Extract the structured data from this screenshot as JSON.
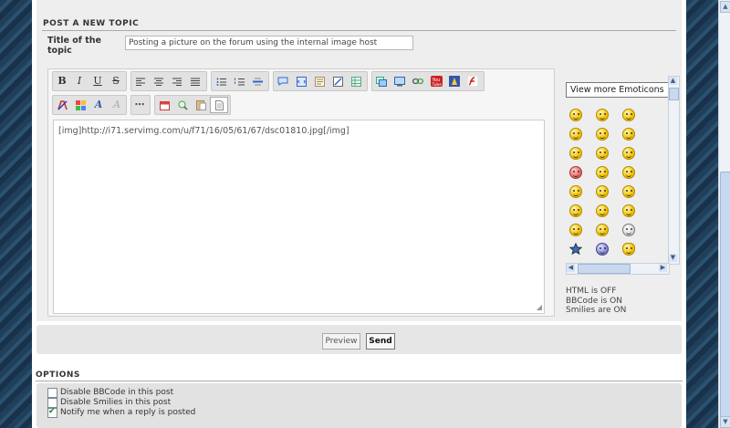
{
  "post_section": {
    "heading": "POST A NEW TOPIC",
    "title_label": "Title of the topic",
    "title_value": "Posting a picture on the forum using the internal image host"
  },
  "toolbar": {
    "row1": [
      "bold",
      "italic",
      "underline",
      "strikethrough",
      "align-left",
      "align-center",
      "align-right",
      "justify",
      "bulleted-list",
      "numbered-list",
      "horizontal-rule",
      "quote",
      "code",
      "spoiler",
      "hide",
      "table",
      "insert-image",
      "host-image",
      "insert-link",
      "youtube",
      "dailymotion",
      "flash"
    ],
    "row2": [
      "font-color",
      "text-gradient",
      "font-face",
      "clear-format",
      "more",
      "date",
      "search",
      "paste",
      "switch-mode"
    ],
    "bold_label": "B",
    "italic_label": "I",
    "underline_label": "U",
    "strike_label": "S"
  },
  "message": "[img]http://i71.servimg.com/u/f71/16/05/61/67/dsc01810.jpg[/img]",
  "emoticons": {
    "select_label": "View more Emoticons",
    "count": 24
  },
  "status": {
    "html": "HTML is OFF",
    "bbcode": "BBCode is ON",
    "smilies": "Smilies are ON"
  },
  "buttons": {
    "preview": "Preview",
    "send": "Send"
  },
  "options": {
    "heading": "OPTIONS",
    "items": [
      {
        "label": "Disable BBCode in this post",
        "checked": false
      },
      {
        "label": "Disable Smilies in this post",
        "checked": false
      },
      {
        "label": "Notify me when a reply is posted",
        "checked": true
      }
    ]
  },
  "colors": {
    "background": "#1d3a52",
    "panel": "#eeeeee",
    "accent": "#3a5f93"
  }
}
